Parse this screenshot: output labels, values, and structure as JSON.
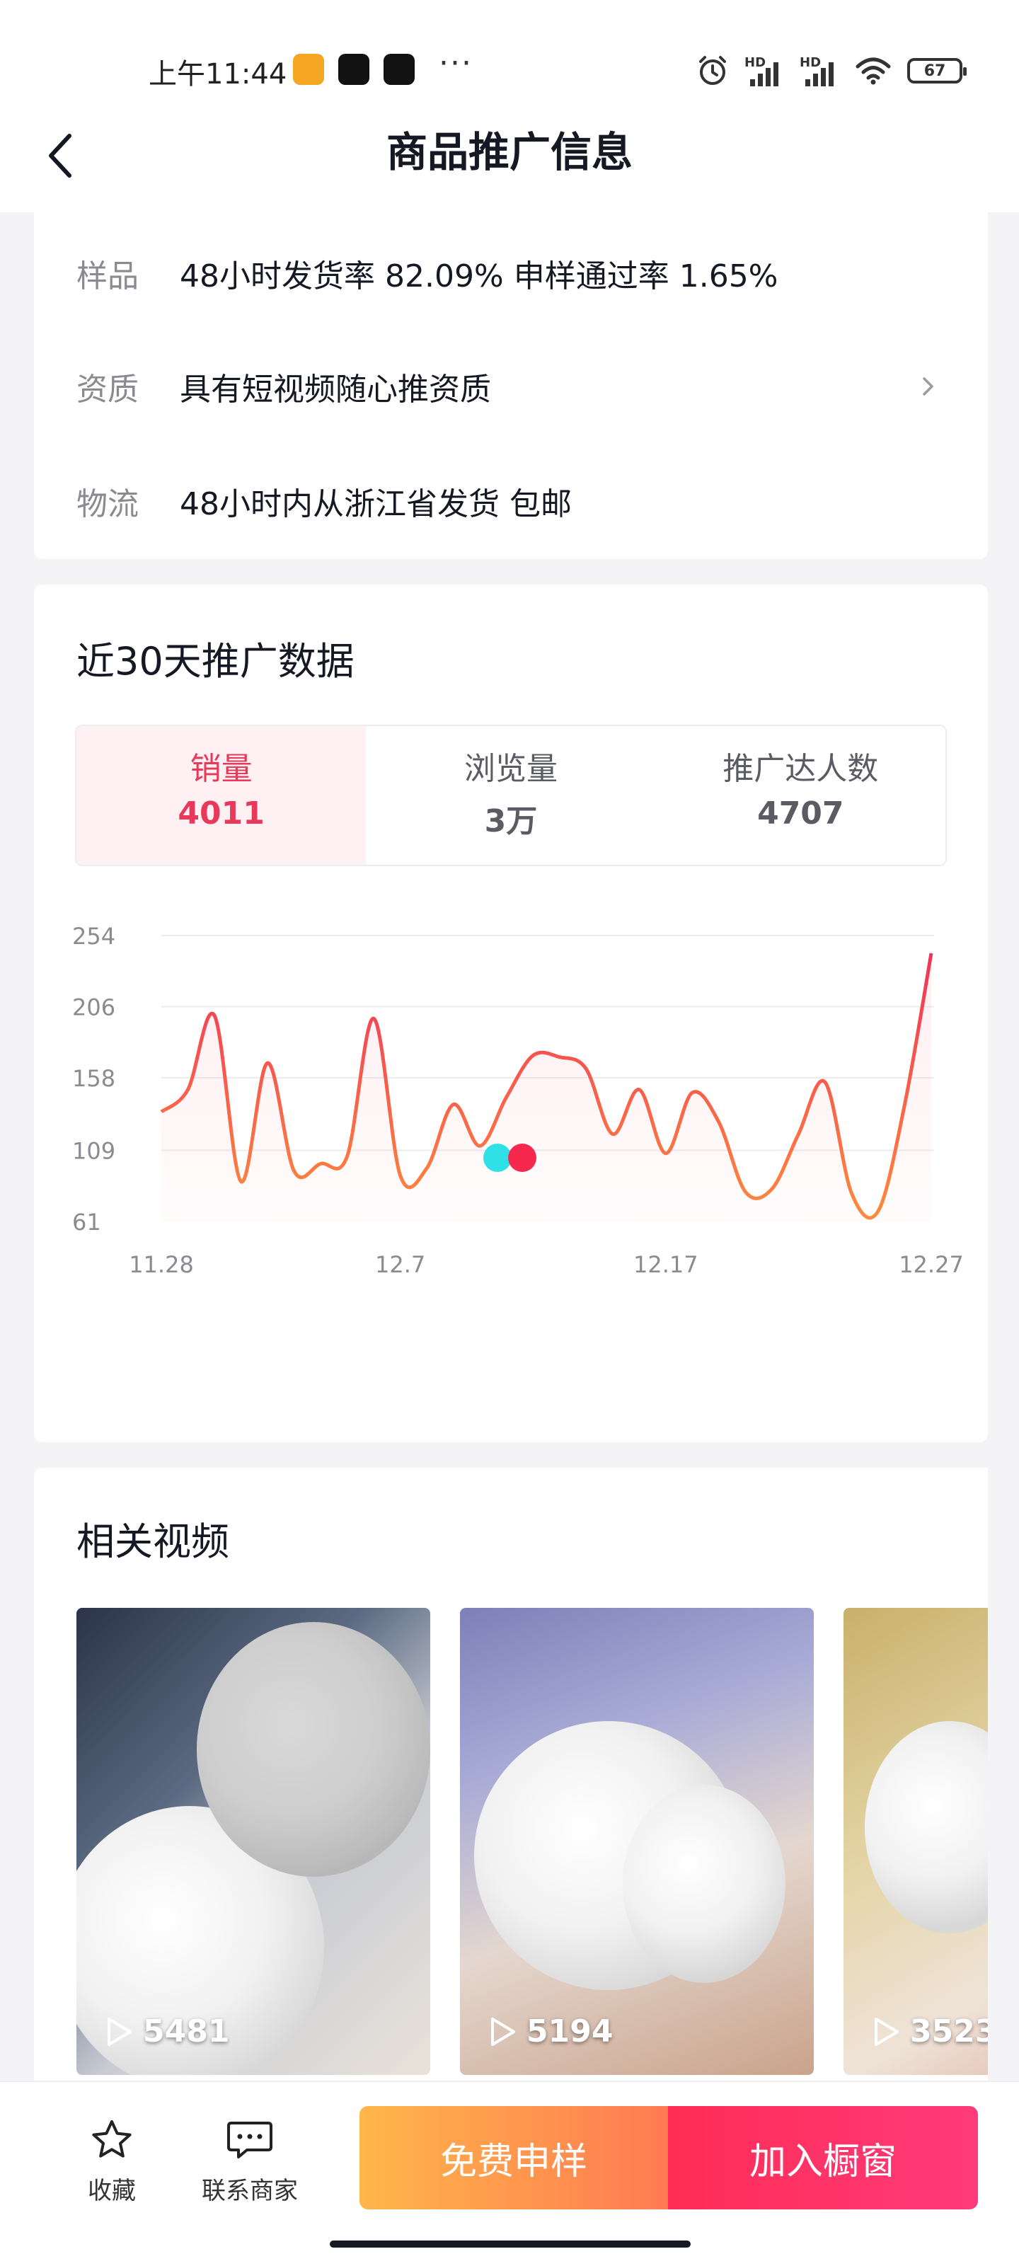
{
  "status_bar": {
    "time": "上午11:44",
    "battery": "67",
    "hd1": "HD",
    "hd2": "HD",
    "more": "···"
  },
  "header": {
    "title": "商品推广信息"
  },
  "info": {
    "rows": [
      {
        "label": "样品",
        "value": "48小时发货率 82.09%  申样通过率 1.65%"
      },
      {
        "label": "资质",
        "value": "具有短视频随心推资质"
      },
      {
        "label": "物流",
        "value": "48小时内从浙江省发货 包邮"
      }
    ]
  },
  "promo": {
    "title": "近30天推广数据",
    "tabs": [
      {
        "label": "销量",
        "value": "4011"
      },
      {
        "label": "浏览量",
        "value": "3万"
      },
      {
        "label": "推广达人数",
        "value": "4707"
      }
    ]
  },
  "chart_data": {
    "type": "line",
    "yticks": [
      "254",
      "206",
      "158",
      "109",
      "61"
    ],
    "ylim": [
      61,
      254
    ],
    "xticks": [
      "11.28",
      "12.7",
      "12.17",
      "12.27"
    ],
    "x": [
      "11.28",
      "11.29",
      "11.30",
      "12.1",
      "12.2",
      "12.3",
      "12.4",
      "12.5",
      "12.6",
      "12.7",
      "12.8",
      "12.9",
      "12.10",
      "12.11",
      "12.12",
      "12.13",
      "12.14",
      "12.15",
      "12.16",
      "12.17",
      "12.18",
      "12.19",
      "12.20",
      "12.21",
      "12.22",
      "12.23",
      "12.24",
      "12.25",
      "12.26",
      "12.27"
    ],
    "series": [
      {
        "values": [
          135,
          150,
          200,
          88,
          168,
          95,
          100,
          105,
          198,
          92,
          97,
          140,
          112,
          145,
          173,
          172,
          164,
          120,
          150,
          107,
          148,
          128,
          81,
          83,
          120,
          155,
          80,
          68,
          140,
          242
        ]
      }
    ],
    "highlight_index": 15,
    "grid": true,
    "colors": {
      "line_start": "#ff8a3d",
      "line_end": "#f0325a",
      "marker_a": "#2fe0e6",
      "marker_b": "#f6284d"
    }
  },
  "videos": {
    "title": "相关视频",
    "items": [
      {
        "count": "5481"
      },
      {
        "count": "5194"
      },
      {
        "count": "3523"
      }
    ]
  },
  "bottom": {
    "favorite": "收藏",
    "contact": "联系商家",
    "free_sample": "免费申样",
    "add_window": "加入橱窗"
  },
  "colors": {
    "accent": "#e8395a",
    "sample_start": "#ffb64a",
    "window_end": "#ff3a7a"
  }
}
